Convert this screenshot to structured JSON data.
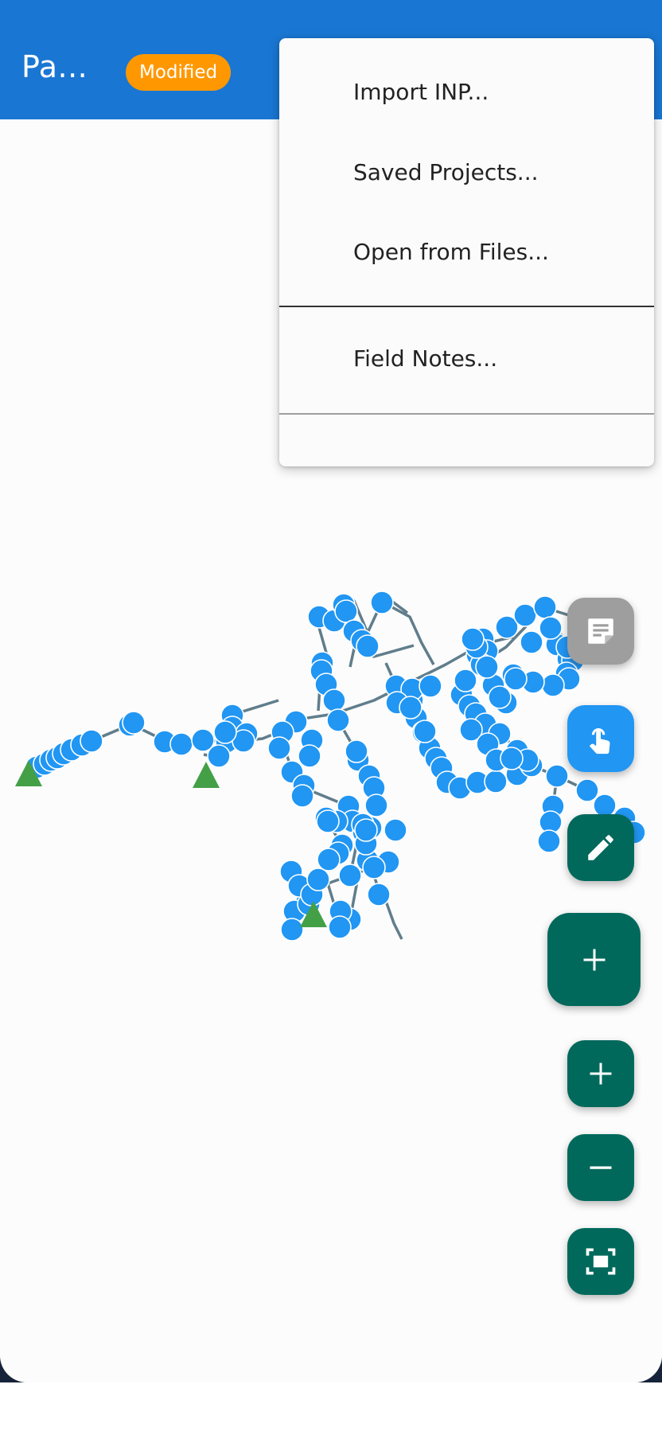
{
  "header": {
    "title": "Pa...",
    "badge": "Modified"
  },
  "menu": {
    "items": [
      {
        "label": "Import INP..."
      },
      {
        "label": "Saved Projects..."
      },
      {
        "label": "Open from Files..."
      },
      {
        "label": "Field Notes..."
      }
    ]
  },
  "map": {
    "junction_color": "#2196f3",
    "reservoir_color": "#43a047",
    "pipe_color": "#607d8b"
  },
  "fabs": [
    {
      "icon": "notes-icon"
    },
    {
      "icon": "touch-icon"
    },
    {
      "icon": "edit-icon"
    },
    {
      "icon": "add-icon"
    },
    {
      "icon": "zoom-in-icon"
    },
    {
      "icon": "zoom-out-icon"
    },
    {
      "icon": "fit-screen-icon"
    }
  ],
  "colors": {
    "app_bar": "#1976d2",
    "badge": "#ff9800",
    "fab_primary": "#00695c",
    "fab_touch": "#2196f3",
    "fab_notes": "#9e9e9e"
  }
}
